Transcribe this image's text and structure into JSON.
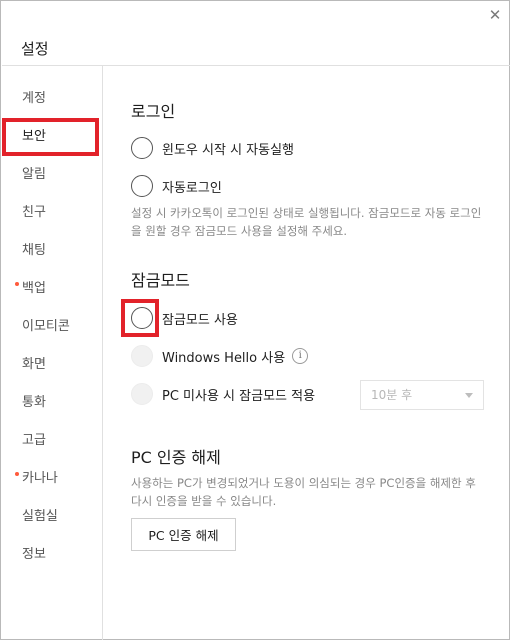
{
  "window": {
    "title": "설정",
    "close_label": "✕"
  },
  "sidebar": {
    "items": [
      {
        "label": "계정",
        "dot": false
      },
      {
        "label": "보안",
        "dot": false,
        "active": true
      },
      {
        "label": "알림",
        "dot": false
      },
      {
        "label": "친구",
        "dot": false
      },
      {
        "label": "채팅",
        "dot": false
      },
      {
        "label": "백업",
        "dot": true
      },
      {
        "label": "이모티콘",
        "dot": false
      },
      {
        "label": "화면",
        "dot": false
      },
      {
        "label": "통화",
        "dot": false
      },
      {
        "label": "고급",
        "dot": false
      },
      {
        "label": "카나나",
        "dot": true
      },
      {
        "label": "실험실",
        "dot": false
      },
      {
        "label": "정보",
        "dot": false
      }
    ]
  },
  "login": {
    "title": "로그인",
    "auto_start_label": "윈도우 시작 시 자동실행",
    "auto_login_label": "자동로그인",
    "description": "설정 시 카카오톡이 로그인된 상태로 실행됩니다. 잠금모드로 자동 로그인을 원할 경우 잠금모드 사용을 설정해 주세요."
  },
  "lock_mode": {
    "title": "잠금모드",
    "use_label": "잠금모드 사용",
    "windows_hello_label": "Windows Hello 사용",
    "info_icon_glyph": "i",
    "idle_lock_label": "PC 미사용 시 잠금모드 적용",
    "idle_select": {
      "value": "10분 후"
    }
  },
  "pc_auth": {
    "title": "PC 인증 해제",
    "description": "사용하는 PC가 변경되었거나 도용이 의심되는 경우 PC인증을 해제한 후 다시 인증을 받을 수 있습니다.",
    "button_label": "PC 인증 해제"
  },
  "colors": {
    "accent_highlight": "#e2222a",
    "notification_dot": "#ff5a3c",
    "description_text": "#888888"
  }
}
